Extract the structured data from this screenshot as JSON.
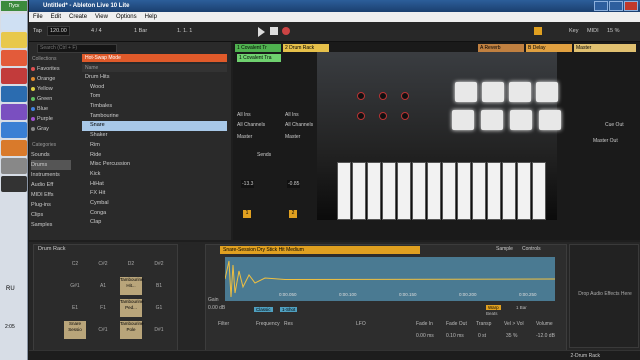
{
  "taskbar": {
    "start_label": "Пуск",
    "language": "RU",
    "clock": "2:05"
  },
  "window": {
    "title": "Untitled* - Ableton Live 10 Lite"
  },
  "menu": [
    "File",
    "Edit",
    "Create",
    "View",
    "Options",
    "Help"
  ],
  "transport": {
    "tap": "Tap",
    "tempo": "120.00",
    "signature": "4 / 4",
    "quantize": "1 Bar",
    "position": "1. 1. 1",
    "key": "Key",
    "midi": "MIDI",
    "cpu": "15 %"
  },
  "browser": {
    "search_placeholder": "Search (Ctrl + F)",
    "collections_label": "Collections",
    "collections": [
      {
        "name": "Favorites",
        "color": "#e05050"
      },
      {
        "name": "Orange",
        "color": "#e08a30"
      },
      {
        "name": "Yellow",
        "color": "#e0d040"
      },
      {
        "name": "Green",
        "color": "#60c060"
      },
      {
        "name": "Blue",
        "color": "#4080e0"
      },
      {
        "name": "Purple",
        "color": "#a050d0"
      },
      {
        "name": "Gray",
        "color": "#888888"
      }
    ],
    "categories_label": "Categories",
    "categories": [
      "Sounds",
      "Drums",
      "Instruments",
      "Audio Eff",
      "MIDI Effs",
      "Plug-ins",
      "Clips",
      "Samples"
    ],
    "hotswap": "Hot-Swap Mode",
    "name_header": "Name",
    "tree": [
      "Drum Hits",
      "Wood",
      "Tom",
      "Timbales",
      "Tambourine",
      "Snare",
      "Shaker",
      "Rim",
      "Ride",
      "Misc Percussion",
      "Kick",
      "HiHat",
      "FX Hit",
      "Cymbal",
      "Conga",
      "Clap"
    ],
    "selected_index": 5
  },
  "tracks": [
    {
      "name": "1 Covalent Tr",
      "color": "#4fb14f"
    },
    {
      "name": "2 Drum Rack",
      "color": "#e6c04a"
    },
    {
      "name": "A Reverb",
      "color": "#c08040"
    },
    {
      "name": "B Delay",
      "color": "#e0a040"
    },
    {
      "name": "Master",
      "color": "#e0c070"
    }
  ],
  "clip": {
    "name": "1 Covalent Tra"
  },
  "mixer": {
    "io": "All Ins",
    "channels": "All Channels",
    "auto": "Auto",
    "off": "Off",
    "master": "Master",
    "sends": "Sends",
    "db1": "-13.3",
    "db2": "-0.85",
    "track_num1": "1",
    "track_num2": "2",
    "cue_out": "Cue Out",
    "master_out": "Master Out"
  },
  "drum_rack": {
    "title": "Drum Rack",
    "rows": [
      [
        "C2",
        "C#2",
        "D2",
        "D#2"
      ],
      [
        "G#1",
        "A1",
        "Tambourine Hit...",
        "B1"
      ],
      [
        "E1",
        "F1",
        "Tambourine Ped...",
        "G1"
      ],
      [
        "Snare Sessio",
        "C#1",
        "Tambourine Pole",
        "D#1"
      ]
    ]
  },
  "simpler": {
    "title": "Snare-Session Dry Stick Hit Medium",
    "tabs": [
      "Sample",
      "Controls"
    ],
    "time_labels": [
      "0:00.000",
      "0:00.050",
      "0:00.100",
      "0:00.150",
      "0:00.200",
      "0:00.250"
    ],
    "gain": "Gain",
    "gain_val": "0.00 dB",
    "mode1": "Classic",
    "mode2": "1-Shot",
    "warp": "Warp",
    "filter": "Filter",
    "freq": "Frequency",
    "res": "Res",
    "lfo": "LFO",
    "fade_in": "Fade In",
    "fade_out": "Fade Out",
    "transp": "Transp",
    "vel_vol": "Vel > Vol",
    "volume": "Volume",
    "fade_in_val": "0.00 ms",
    "fade_out_val": "0.10 ms",
    "transp_val": "0 st",
    "vel_val": "35 %",
    "vol_val": "-12.0 dB",
    "beats": "Beats",
    "one_bar": "1 Bar",
    "snap": "Snap"
  },
  "dropzone": {
    "text": "Drop Audio Effects Here"
  },
  "status": {
    "track": "2-Drum Rack"
  }
}
